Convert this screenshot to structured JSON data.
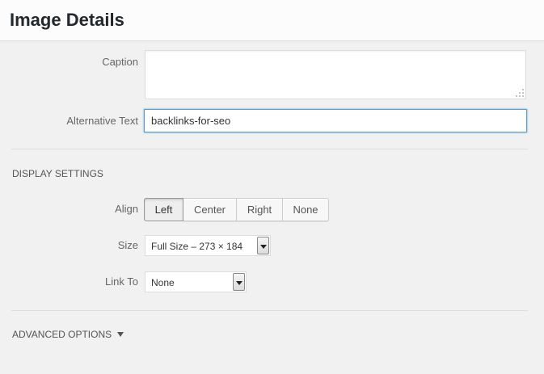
{
  "header": {
    "title": "Image Details"
  },
  "fields": {
    "caption_label": "Caption",
    "caption_value": "",
    "alt_label": "Alternative Text",
    "alt_value": "backlinks-for-seo"
  },
  "display_settings": {
    "heading": "DISPLAY SETTINGS",
    "align_label": "Align",
    "align_options": [
      "Left",
      "Center",
      "Right",
      "None"
    ],
    "align_selected": "Left",
    "size_label": "Size",
    "size_value": "Full Size – 273 × 184",
    "link_label": "Link To",
    "link_value": "None"
  },
  "advanced": {
    "heading": "ADVANCED OPTIONS",
    "icon": "triangle-down-icon"
  },
  "colors": {
    "focus_border": "#5b9dd9",
    "background": "#f1f1f1"
  }
}
